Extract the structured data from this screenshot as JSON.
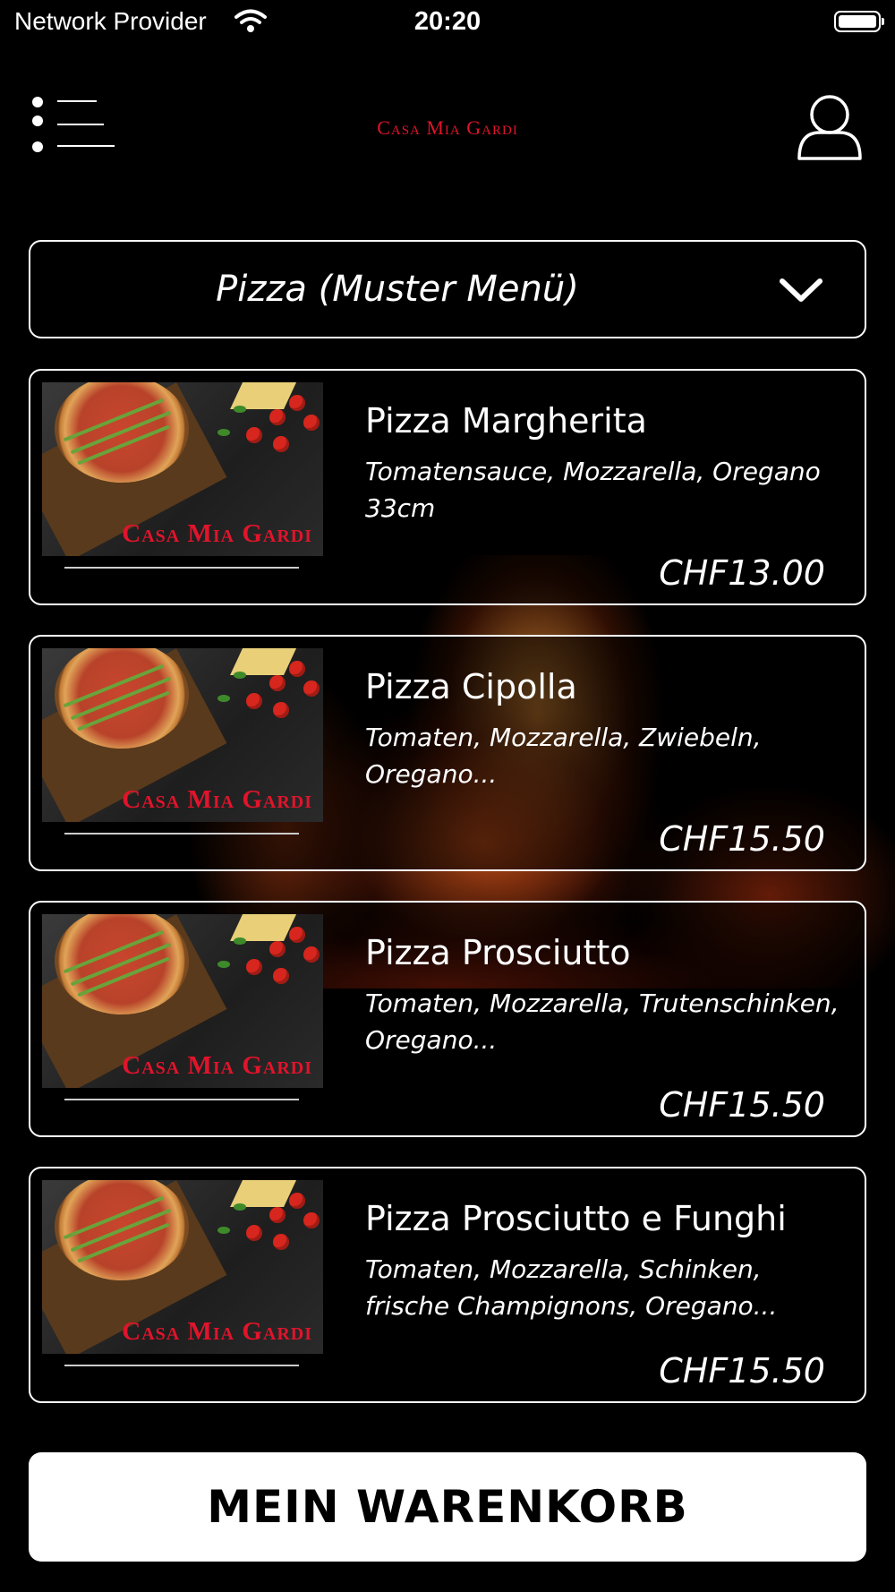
{
  "status_bar": {
    "carrier": "Network Provider",
    "time": "20:20"
  },
  "header": {
    "logo": "Casa Mia Gardi"
  },
  "category_select": {
    "selected": "Pizza (Muster Menü)"
  },
  "thumbnail_brand": "Casa Mia Gardi",
  "items": [
    {
      "name": "Pizza Margherita",
      "description": "Tomatensauce, Mozzarella, Oregano 33cm",
      "price": "CHF13.00"
    },
    {
      "name": "Pizza Cipolla",
      "description": "Tomaten, Mozzarella, Zwiebeln, Oregano...",
      "price": "CHF15.50"
    },
    {
      "name": "Pizza Prosciutto",
      "description": "Tomaten, Mozzarella, Trutenschinken, Oregano...",
      "price": "CHF15.50"
    },
    {
      "name": "Pizza Prosciutto e Funghi",
      "description": "Tomaten, Mozzarella, Schinken, frische Champignons, Oregano...",
      "price": "CHF15.50"
    }
  ],
  "cart_button": {
    "label": "MEIN WARENKORB"
  },
  "colors": {
    "background": "#000000",
    "brand_red": "#e0142b",
    "text": "#ffffff"
  },
  "icons": {
    "menu": "list-menu-icon",
    "profile": "user-profile-icon",
    "dropdown": "chevron-down-icon",
    "wifi": "wifi-icon",
    "battery": "battery-icon"
  }
}
